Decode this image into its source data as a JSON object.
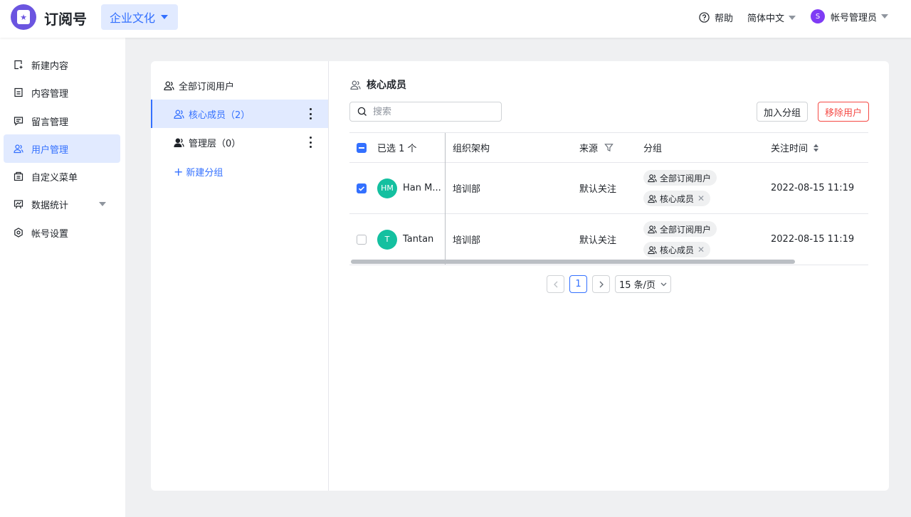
{
  "header": {
    "app_title": "订阅号",
    "workspace": "企业文化",
    "help": "帮助",
    "language": "简体中文",
    "user_initial": "S",
    "user_name": "帐号管理员"
  },
  "sidebar": {
    "items": [
      {
        "label": "新建内容",
        "icon": "new-content-icon"
      },
      {
        "label": "内容管理",
        "icon": "document-icon"
      },
      {
        "label": "留言管理",
        "icon": "message-icon"
      },
      {
        "label": "用户管理",
        "icon": "users-icon",
        "active": true
      },
      {
        "label": "自定义菜单",
        "icon": "menu-icon"
      },
      {
        "label": "数据统计",
        "icon": "chart-icon",
        "expandable": true
      },
      {
        "label": "帐号设置",
        "icon": "gear-icon"
      }
    ]
  },
  "groups": {
    "all_label": "全部订阅用户",
    "items": [
      {
        "label": "核心成员（2）",
        "selected": true
      },
      {
        "label": "管理层（0）",
        "selected": false
      }
    ],
    "new_group": "新建分组"
  },
  "panel": {
    "title": "核心成员",
    "search_placeholder": "搜索",
    "add_to_group": "加入分组",
    "remove_user": "移除用户"
  },
  "table": {
    "columns": {
      "selected": "已选 1 个",
      "org": "组织架构",
      "source": "来源",
      "group": "分组",
      "follow_time": "关注时间"
    },
    "rows": [
      {
        "checked": true,
        "initials": "HM",
        "name": "Han M...",
        "org": "培训部",
        "source": "默认关注",
        "tags": [
          "全部订阅用户",
          "核心成员"
        ],
        "time": "2022-08-15 11:19"
      },
      {
        "checked": false,
        "initials": "T",
        "name": "Tantan",
        "org": "培训部",
        "source": "默认关注",
        "tags": [
          "全部订阅用户",
          "核心成员"
        ],
        "time": "2022-08-15 11:19"
      }
    ]
  },
  "pagination": {
    "current": "1",
    "page_size": "15 条/页"
  },
  "colors": {
    "accent": "#3370ff",
    "danger": "#f54a45",
    "avatar": "#14c0a0",
    "logo": "#6b55e0"
  }
}
